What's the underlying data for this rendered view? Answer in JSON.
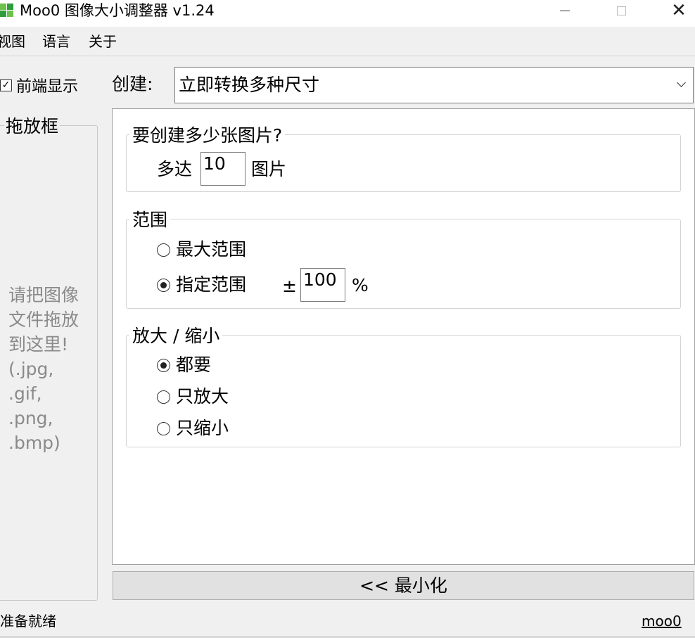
{
  "window": {
    "title": "Moo0 图像大小调整器 v1.24",
    "app_icon": "moo0-grid-icon",
    "controls": {
      "minimize": "minimize-icon",
      "maximize": "maximize-icon",
      "close": "close-icon"
    }
  },
  "menu": [
    {
      "label": "视图"
    },
    {
      "label": "语言"
    },
    {
      "label": "关于"
    }
  ],
  "options": {
    "always_on_top": {
      "label": "前端显示",
      "checked": true
    },
    "create_label": "创建:",
    "create_select": {
      "value": "立即转换多种尺寸"
    }
  },
  "drop_box": {
    "title": "拖放框",
    "hint": "请把图像文件拖放到这里!\n(.jpg,\n.gif,\n.png,\n.bmp)"
  },
  "count_group": {
    "title": "要创建多少张图片?",
    "prefix": "多达",
    "value": "10",
    "suffix": "图片"
  },
  "range_group": {
    "title": "范围",
    "options": [
      {
        "label": "最大范围",
        "selected": false
      },
      {
        "label": "指定范围",
        "selected": true
      }
    ],
    "plus_minus": "±",
    "value": "100",
    "unit": "%"
  },
  "scale_group": {
    "title": "放大 / 缩小",
    "options": [
      {
        "label": "都要",
        "selected": true
      },
      {
        "label": "只放大",
        "selected": false
      },
      {
        "label": "只缩小",
        "selected": false
      }
    ]
  },
  "minimize_button": {
    "label": "<< 最小化"
  },
  "status": {
    "text": "准备就绪",
    "link": "moo0"
  }
}
